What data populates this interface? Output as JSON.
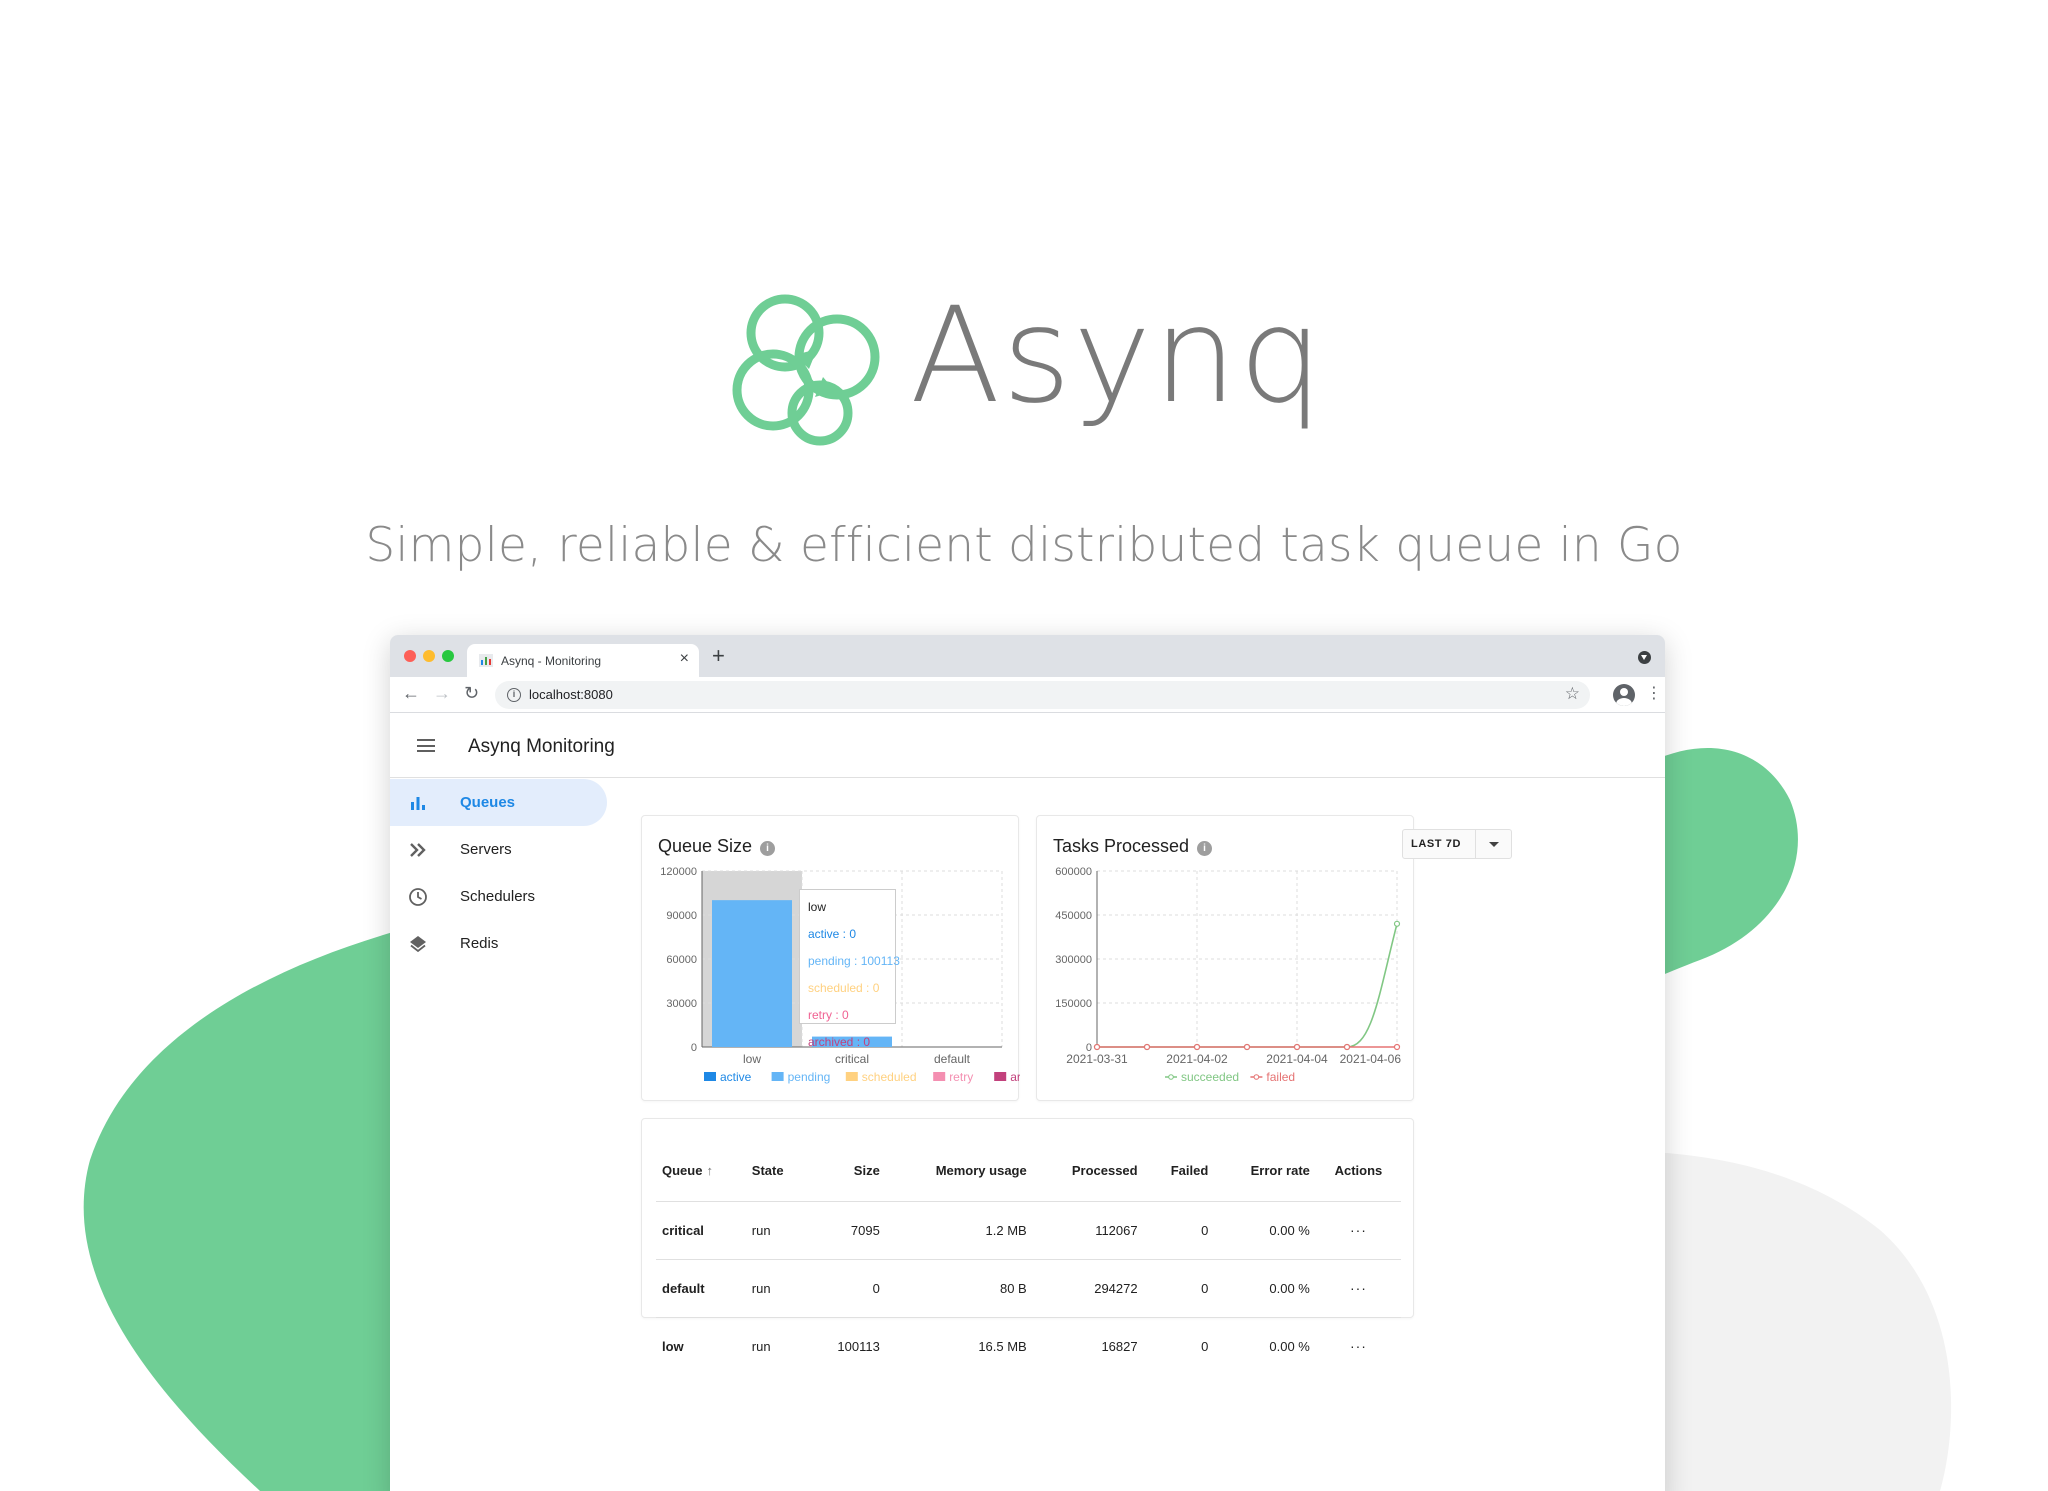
{
  "hero": {
    "title": "Asynq",
    "subtitle": "Simple, reliable & efficient distributed task queue in Go"
  },
  "colors": {
    "brand_green": "#6fce95",
    "blob_gray": "#f0f0f0",
    "accent_blue": "#1e88e5",
    "run_green": "#43a047"
  },
  "browser": {
    "tab_title": "Asynq - Monitoring",
    "tab_close": "×",
    "new_tab": "+",
    "url": "localhost:8080",
    "back": "←",
    "forward": "→",
    "reload": "↻",
    "star": "☆",
    "menu": "⋮"
  },
  "app": {
    "title": "Asynq Monitoring"
  },
  "sidebar": {
    "items": [
      {
        "label": "Queues",
        "icon": "bar-chart-icon",
        "active": true
      },
      {
        "label": "Servers",
        "icon": "double-chevron-icon",
        "active": false
      },
      {
        "label": "Schedulers",
        "icon": "clock-icon",
        "active": false
      },
      {
        "label": "Redis",
        "icon": "layers-icon",
        "active": false
      }
    ]
  },
  "queue_size": {
    "title": "Queue Size",
    "help": "i",
    "tooltip": {
      "title": "low",
      "active": "active : 0",
      "pending": "pending : 100113",
      "scheduled": "scheduled : 0",
      "retry": "retry : 0",
      "archived": "archived : 0"
    }
  },
  "tasks_processed": {
    "title": "Tasks Processed",
    "help": "i",
    "range_label": "LAST 7D"
  },
  "chart_data": [
    {
      "type": "bar",
      "title": "Queue Size",
      "categories": [
        "low",
        "critical",
        "default"
      ],
      "series": [
        {
          "name": "active",
          "color": "#1e88e5",
          "values": [
            0,
            0,
            0
          ]
        },
        {
          "name": "pending",
          "color": "#64b5f6",
          "values": [
            100113,
            7095,
            0
          ]
        },
        {
          "name": "scheduled",
          "color": "#ffd180",
          "values": [
            0,
            0,
            0
          ]
        },
        {
          "name": "retry",
          "color": "#f48fb1",
          "values": [
            0,
            0,
            0
          ]
        },
        {
          "name": "archived",
          "color": "#c2417c",
          "values": [
            0,
            0,
            0
          ]
        }
      ],
      "stacked": true,
      "ylim": [
        0,
        120000
      ],
      "yticks": [
        "0",
        "30000",
        "60000",
        "90000",
        "120000"
      ],
      "highlighted_category": "low",
      "grid": true,
      "legend": "bottom"
    },
    {
      "type": "line",
      "title": "Tasks Processed",
      "x": [
        "2021-03-31",
        "2021-04-01",
        "2021-04-02",
        "2021-04-03",
        "2021-04-04",
        "2021-04-05",
        "2021-04-06"
      ],
      "xticks": [
        "2021-03-31",
        "2021-04-02",
        "2021-04-04",
        "2021-04-06"
      ],
      "series": [
        {
          "name": "succeeded",
          "color": "#81c784",
          "values": [
            0,
            0,
            0,
            0,
            0,
            0,
            420000
          ]
        },
        {
          "name": "failed",
          "color": "#e57373",
          "values": [
            0,
            0,
            0,
            0,
            0,
            0,
            0
          ]
        }
      ],
      "ylim": [
        0,
        600000
      ],
      "yticks": [
        "0",
        "150000",
        "300000",
        "450000",
        "600000"
      ],
      "grid": true,
      "legend": "bottom"
    }
  ],
  "table": {
    "headers": {
      "queue": "Queue",
      "sort": "↑",
      "state": "State",
      "size": "Size",
      "memory": "Memory usage",
      "processed": "Processed",
      "failed": "Failed",
      "error_rate": "Error rate",
      "actions": "Actions"
    },
    "rows": [
      {
        "queue": "critical",
        "state": "run",
        "size": "7095",
        "memory": "1.2 MB",
        "processed": "112067",
        "failed": "0",
        "error_rate": "0.00 %",
        "actions": "···"
      },
      {
        "queue": "default",
        "state": "run",
        "size": "0",
        "memory": "80 B",
        "processed": "294272",
        "failed": "0",
        "error_rate": "0.00 %",
        "actions": "···"
      },
      {
        "queue": "low",
        "state": "run",
        "size": "100113",
        "memory": "16.5 MB",
        "processed": "16827",
        "failed": "0",
        "error_rate": "0.00 %",
        "actions": "···"
      }
    ]
  }
}
